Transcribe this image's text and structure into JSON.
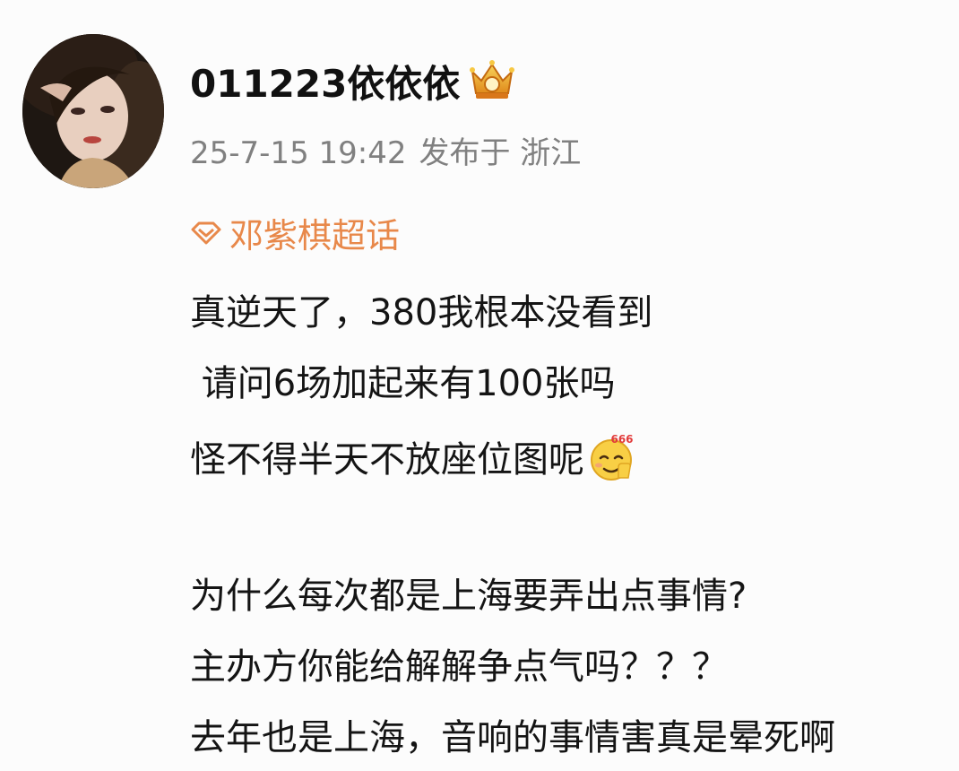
{
  "post": {
    "username": "011223依依依",
    "timestamp": "25-7-15 19:42",
    "location": "发布于 浙江",
    "topic": "邓紫棋超话",
    "lines": [
      "真逆天了，380我根本没看到",
      " 请问6场加起来有100张吗",
      "怪不得半天不放座位图呢",
      "为什么每次都是上海要弄出点事情?",
      "主办方你能给解解争点气吗？？？",
      "去年也是上海，音响的事情害真是晕死啊"
    ],
    "emoji_label": "666"
  },
  "colors": {
    "topic": "#e8884a",
    "meta": "#808080",
    "text": "#141414",
    "background": "#fcfcfc"
  },
  "icons": {
    "avatar": "user-avatar",
    "crown": "vip-crown-icon",
    "topic": "diamond-topic-icon",
    "emoji": "666-thumbs-emoji-icon"
  }
}
